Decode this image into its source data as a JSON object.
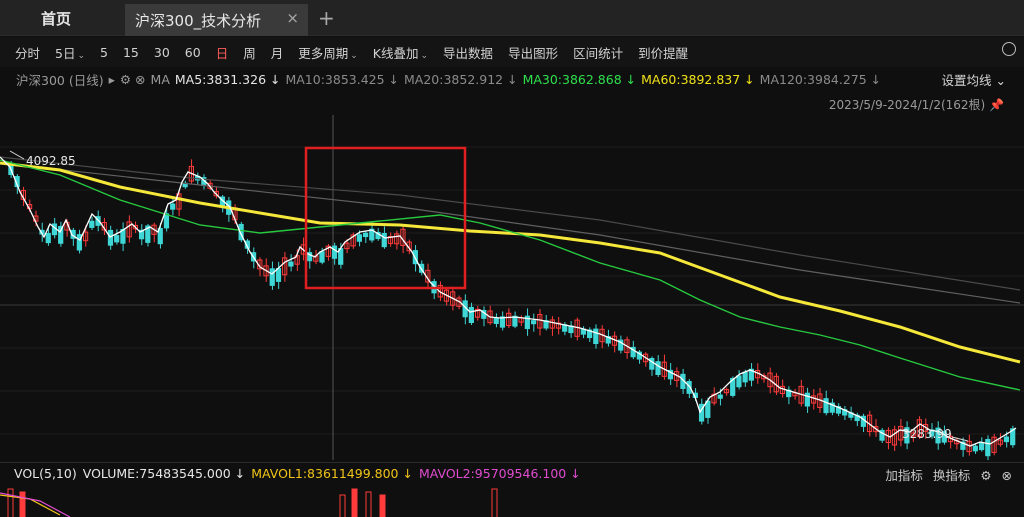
{
  "tabs": {
    "home_label": "首页",
    "active_label": "沪深300_技术分析",
    "close_glyph": "×",
    "new_glyph": "+"
  },
  "toolbar": {
    "items": [
      {
        "label": "分时",
        "chev": ""
      },
      {
        "label": "5日",
        "chev": "⌄"
      },
      {
        "label": "5",
        "chev": ""
      },
      {
        "label": "15",
        "chev": ""
      },
      {
        "label": "30",
        "chev": ""
      },
      {
        "label": "60",
        "chev": ""
      },
      {
        "label": "日",
        "chev": "",
        "active": true
      },
      {
        "label": "周",
        "chev": ""
      },
      {
        "label": "月",
        "chev": ""
      },
      {
        "label": "更多周期",
        "chev": "⌄"
      },
      {
        "label": "K线叠加",
        "chev": "⌄"
      },
      {
        "label": "导出数据",
        "chev": ""
      },
      {
        "label": "导出图形",
        "chev": ""
      },
      {
        "label": "区间统计",
        "chev": ""
      },
      {
        "label": "到价提醒",
        "chev": ""
      }
    ]
  },
  "ma": {
    "instrument": "沪深300 (日线)",
    "arrow": "▸",
    "icons": "⚙ ⊗",
    "ma_label": "MA",
    "ma5": "MA5:3831.326 ↓",
    "ma10": "MA10:3853.425 ↓",
    "ma20": "MA20:3852.912 ↓",
    "ma30": "MA30:3862.868 ↓",
    "ma60": "MA60:3892.837 ↓",
    "ma120": "MA120:3984.275 ↓",
    "settings": "设置均线 ⌄",
    "range": "2023/5/9-2024/1/2(162根) 📌"
  },
  "chart_data": {
    "type": "candlestick",
    "high_label": "4092.85",
    "low_label": "3283.99",
    "colors": {
      "up": "#ff3b3b",
      "down": "#3fd6d6",
      "ma5": "#ffffff",
      "ma30": "#27c93f",
      "ma60": "#f5e83a",
      "ma120": "#606060"
    },
    "highlight_box_color": "#e02020"
  },
  "volume": {
    "label": "VOL(5,10)",
    "volume": "VOLUME:75483545.000 ↓",
    "mavol1": "MAVOL1:83611499.800 ↓",
    "mavol2": "MAVOL2:95709546.100 ↓",
    "add_indicator": "加指标",
    "switch_indicator": "换指标",
    "gear": "⚙",
    "close": "⊗"
  }
}
